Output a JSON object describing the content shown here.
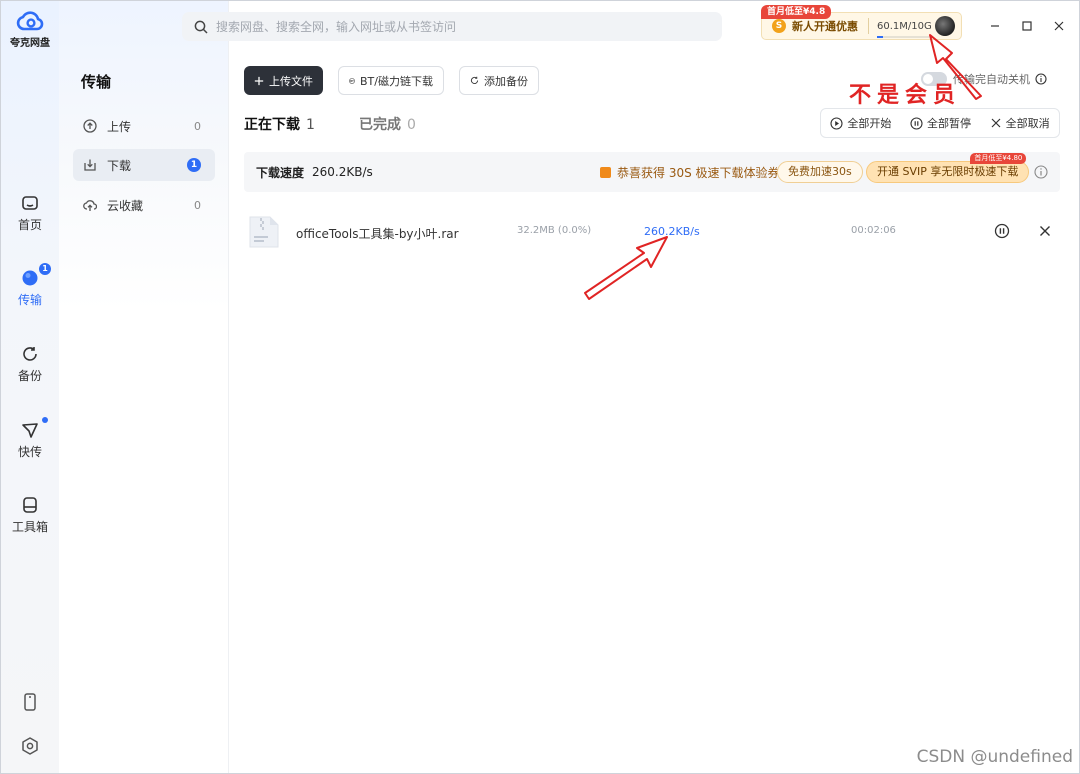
{
  "app": {
    "logo_text": "夸克网盘"
  },
  "rail": {
    "items": [
      {
        "label": "首页"
      },
      {
        "label": "传输",
        "badge": "1"
      },
      {
        "label": "备份"
      },
      {
        "label": "快传"
      },
      {
        "label": "工具箱"
      }
    ]
  },
  "sidebar": {
    "title": "传输",
    "items": [
      {
        "label": "上传",
        "count": "0"
      },
      {
        "label": "下载",
        "count": "1"
      },
      {
        "label": "云收藏",
        "count": "0"
      }
    ]
  },
  "search": {
    "placeholder": "搜索网盘、搜索全网，输入网址或从书签访问"
  },
  "promo": {
    "flag": "首月低至¥4.8",
    "icon_text": "S",
    "text": "新人开通优惠",
    "quota": "60.1M/10G",
    "quota_fraction": 0.006
  },
  "toolbar": {
    "upload_label": "上传文件",
    "bt_label": "BT/磁力链下载",
    "backup_label": "添加备份",
    "auto_shutdown_label": "传输完自动关机"
  },
  "tabs": [
    {
      "label": "正在下载",
      "count": "1"
    },
    {
      "label": "已完成",
      "count": "0"
    }
  ],
  "group_actions": {
    "start_all": "全部开始",
    "pause_all": "全部暂停",
    "cancel_all": "全部取消"
  },
  "speed_bar": {
    "label": "下载速度",
    "value": "260.2KB/s",
    "coupon_text": "恭喜获得 30S 极速下载体验券",
    "free_boost": "免费加速30s",
    "svip_button": "开通 SVIP 享无限时极速下载",
    "svip_flag": "首月低至¥4.80"
  },
  "downloads": [
    {
      "name": "officeTools工具集-by小叶.rar",
      "size": "32.2MB (0.0%)",
      "speed": "260.2KB/s",
      "time_left": "00:02:06"
    }
  ],
  "annotation": {
    "text": "不是会员"
  },
  "watermark": "CSDN @undefined",
  "colors": {
    "accent": "#2f6df6",
    "annotation": "#e02424",
    "promo_bg": "#fff7e6"
  }
}
